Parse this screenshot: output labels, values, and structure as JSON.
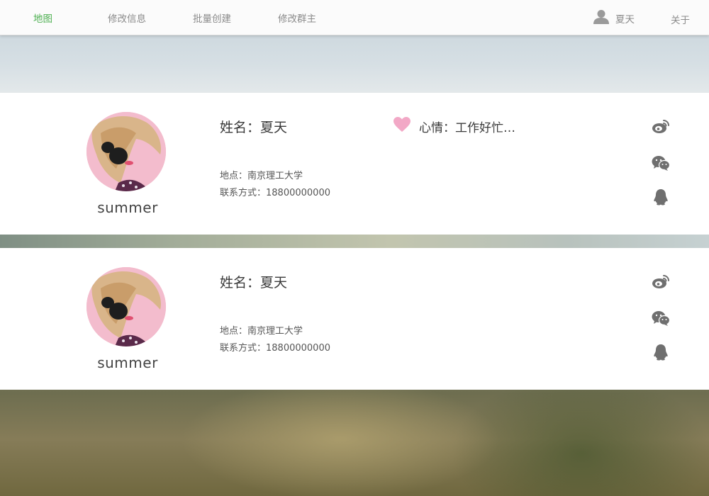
{
  "nav": {
    "items": [
      {
        "label": "地图",
        "active": true
      },
      {
        "label": "修改信息",
        "active": false
      },
      {
        "label": "批量创建",
        "active": false
      },
      {
        "label": "修改群主",
        "active": false
      }
    ],
    "user_name": "夏天",
    "about": "关于",
    "user_icon": "user-icon",
    "active_color": "#4caf50"
  },
  "cards": [
    {
      "username": "summer",
      "name_line": "姓名：夏天",
      "mood_line": "心情：工作好忙…",
      "mood_icon": "heart-icon",
      "address_line": "地点：南京理工大学",
      "contact_line": "联系方式：18800000000",
      "social_icons": [
        "weibo-icon",
        "wechat-icon",
        "qq-icon"
      ]
    },
    {
      "username": "summer",
      "name_line": "姓名：夏天",
      "address_line": "地点：南京理工大学",
      "contact_line": "联系方式：18800000000",
      "social_icons": [
        "weibo-icon",
        "wechat-icon",
        "qq-icon"
      ]
    }
  ]
}
